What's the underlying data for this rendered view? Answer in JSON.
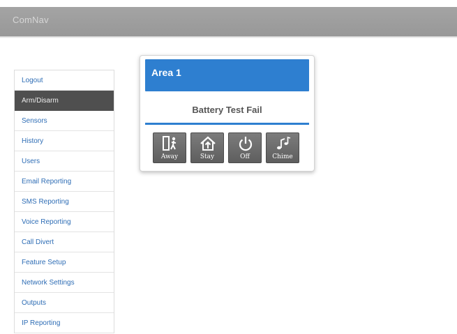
{
  "header": {
    "brand": "ComNav"
  },
  "sidebar": {
    "items": [
      {
        "label": "Logout"
      },
      {
        "label": "Arm/Disarm"
      },
      {
        "label": "Sensors"
      },
      {
        "label": "History"
      },
      {
        "label": "Users"
      },
      {
        "label": "Email Reporting"
      },
      {
        "label": "SMS Reporting"
      },
      {
        "label": "Voice Reporting"
      },
      {
        "label": "Call Divert"
      },
      {
        "label": "Feature Setup"
      },
      {
        "label": "Network Settings"
      },
      {
        "label": "Outputs"
      },
      {
        "label": "IP Reporting"
      }
    ],
    "active_item": "Arm/Disarm"
  },
  "area_card": {
    "title": "Area 1",
    "status": "Battery Test Fail",
    "buttons": [
      {
        "label": "Away",
        "icon": "person-exit-door-icon"
      },
      {
        "label": "Stay",
        "icon": "home-arrow-icon"
      },
      {
        "label": "Off",
        "icon": "power-icon"
      },
      {
        "label": "Chime",
        "icon": "music-notes-icon"
      }
    ]
  },
  "colors": {
    "accent": "#2e7fd0",
    "topbar": "#a0a0a0",
    "active_nav": "#4f4f4f",
    "link": "#2e6db5"
  }
}
